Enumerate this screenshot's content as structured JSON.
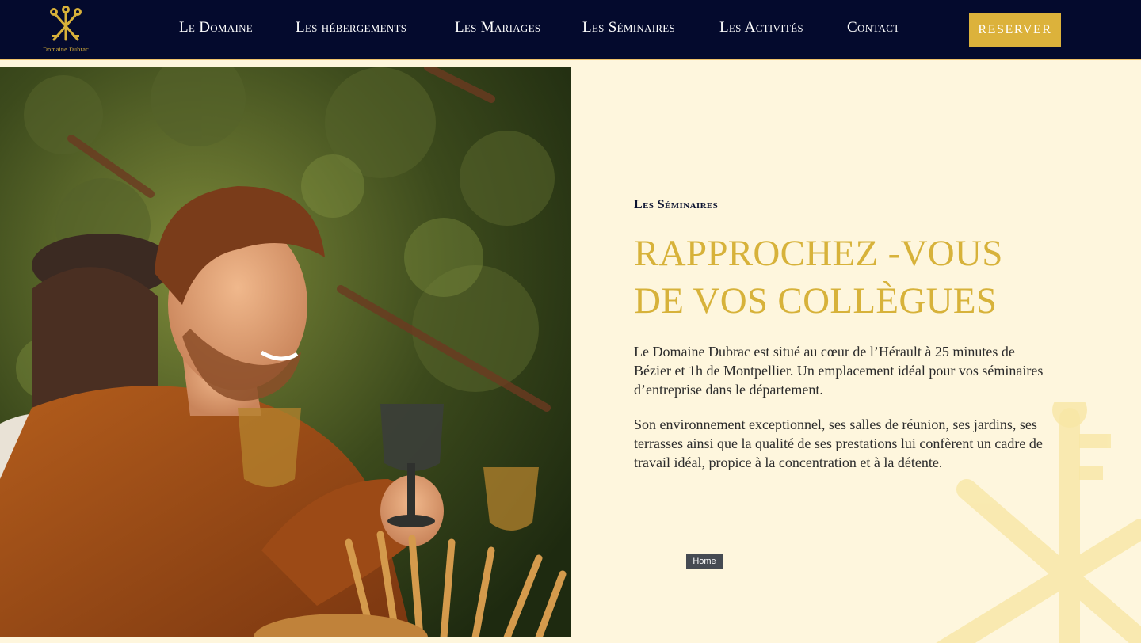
{
  "brand": {
    "name": "Domaine Dubrac",
    "logo_icon": "crossed-keys-icon"
  },
  "nav": {
    "items": [
      {
        "label": "Le Domaine"
      },
      {
        "label": "Les hébergements"
      },
      {
        "label": "Les Mariages"
      },
      {
        "label": "Les Séminaires"
      },
      {
        "label": "Les Activités"
      },
      {
        "label": "Contact"
      }
    ],
    "reserve_label": "RESERVER"
  },
  "hero": {
    "image_icon": "seminar-photo"
  },
  "section": {
    "eyebrow": "Les Séminaires",
    "title_line1": "RAPPROCHEZ -VOUS",
    "title_line2": "DE VOS COLLÈGUES",
    "paragraph1": "Le Domaine Dubrac est situé au cœur de l’Hérault à 25 minutes de Bézier et 1h de Montpellier. Un emplacement idéal pour vos séminaires d’entreprise dans le département.",
    "paragraph2": "Son environnement exceptionnel, ses salles de réunion, ses jardins, ses terrasses ainsi que la qualité de ses prestations lui confèrent un cadre de travail idéal, propice à la concentration et à la détente.",
    "tooltip": "Home"
  },
  "colors": {
    "header_bg": "#040a2d",
    "accent_gold": "#dcb23b",
    "page_bg": "#fef6dd",
    "text_dark": "#2b2b2b"
  }
}
